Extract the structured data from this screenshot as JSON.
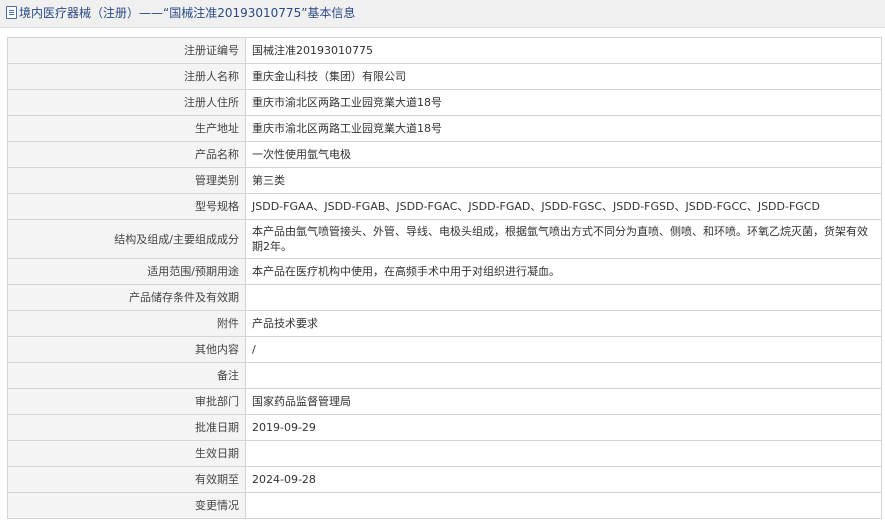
{
  "header": {
    "title": "境内医疗器械（注册）——“国械注准20193010775”基本信息"
  },
  "rows": [
    {
      "label": "注册证编号",
      "value": "国械注准20193010775"
    },
    {
      "label": "注册人名称",
      "value": "重庆金山科技（集团）有限公司"
    },
    {
      "label": "注册人住所",
      "value": "重庆市渝北区两路工业园竞業大道18号"
    },
    {
      "label": "生产地址",
      "value": "重庆市渝北区两路工业园竞業大道18号"
    },
    {
      "label": "产品名称",
      "value": "一次性使用氩气电极"
    },
    {
      "label": "管理类别",
      "value": "第三类"
    },
    {
      "label": "型号规格",
      "value": "JSDD-FGAA、JSDD-FGAB、JSDD-FGAC、JSDD-FGAD、JSDD-FGSC、JSDD-FGSD、JSDD-FGCC、JSDD-FGCD"
    },
    {
      "label": "结构及组成/主要组成成分",
      "value": "本产品由氩气喷管接头、外管、导线、电极头组成，根据氩气喷出方式不同分为直喷、侧喷、和环喷。环氧乙烷灭菌，货架有效期2年。"
    },
    {
      "label": "适用范围/预期用途",
      "value": "本产品在医疗机构中使用，在高频手术中用于对组织进行凝血。"
    },
    {
      "label": "产品储存条件及有效期",
      "value": ""
    },
    {
      "label": "附件",
      "value": "产品技术要求"
    },
    {
      "label": "其他内容",
      "value": "/"
    },
    {
      "label": "备注",
      "value": ""
    },
    {
      "label": "审批部门",
      "value": "国家药品监督管理局"
    },
    {
      "label": "批准日期",
      "value": "2019-09-29"
    },
    {
      "label": "生效日期",
      "value": ""
    },
    {
      "label": "有效期至",
      "value": "2024-09-28"
    },
    {
      "label": "变更情况",
      "value": ""
    }
  ]
}
